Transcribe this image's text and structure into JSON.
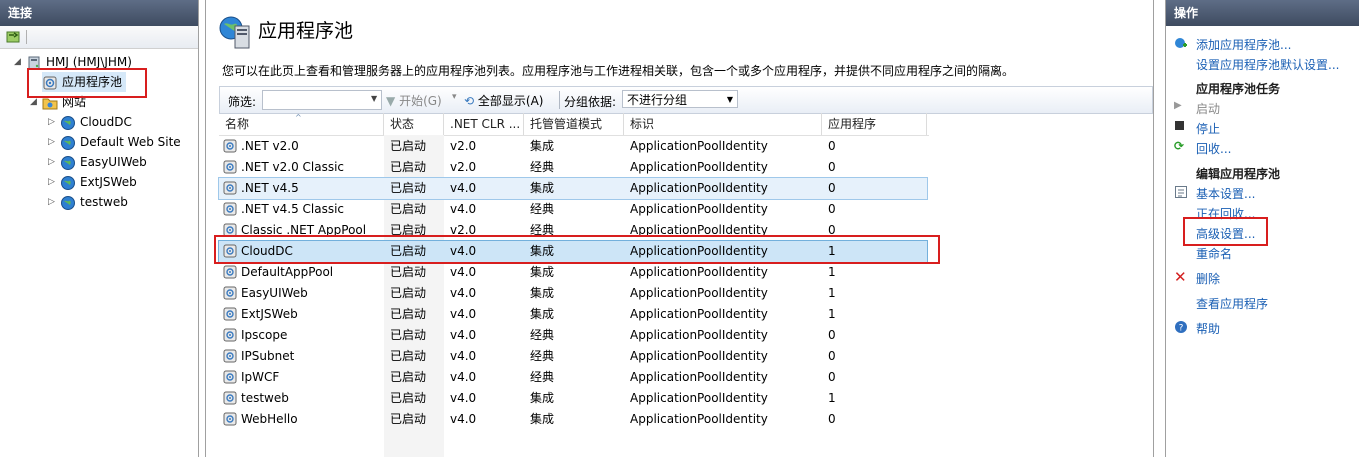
{
  "connections": {
    "header": "连接",
    "tree": {
      "server": "HMJ (HMJ\\JHM)",
      "app_pools": "应用程序池",
      "sites": "网站",
      "site_items": [
        "CloudDC",
        "Default Web Site",
        "EasyUIWeb",
        "ExtJSWeb",
        "testweb"
      ]
    }
  },
  "main": {
    "title": "应用程序池",
    "description": "您可以在此页上查看和管理服务器上的应用程序池列表。应用程序池与工作进程相关联，包含一个或多个应用程序，并提供不同应用程序之间的隔离。",
    "filterbar": {
      "filter_label": "筛选:",
      "start_label": "开始(G)",
      "show_all_label": "全部显示(A)",
      "group_label": "分组依据:",
      "group_value": "不进行分组"
    },
    "columns": [
      "名称",
      "状态",
      ".NET CLR ...",
      "托管管道模式",
      "标识",
      "应用程序"
    ],
    "rows": [
      [
        ".NET v2.0",
        "已启动",
        "v2.0",
        "集成",
        "ApplicationPoolIdentity",
        "0"
      ],
      [
        ".NET v2.0 Classic",
        "已启动",
        "v2.0",
        "经典",
        "ApplicationPoolIdentity",
        "0"
      ],
      [
        ".NET v4.5",
        "已启动",
        "v4.0",
        "集成",
        "ApplicationPoolIdentity",
        "0"
      ],
      [
        ".NET v4.5 Classic",
        "已启动",
        "v4.0",
        "经典",
        "ApplicationPoolIdentity",
        "0"
      ],
      [
        "Classic .NET AppPool",
        "已启动",
        "v2.0",
        "经典",
        "ApplicationPoolIdentity",
        "0"
      ],
      [
        "CloudDC",
        "已启动",
        "v4.0",
        "集成",
        "ApplicationPoolIdentity",
        "1"
      ],
      [
        "DefaultAppPool",
        "已启动",
        "v4.0",
        "集成",
        "ApplicationPoolIdentity",
        "1"
      ],
      [
        "EasyUIWeb",
        "已启动",
        "v4.0",
        "集成",
        "ApplicationPoolIdentity",
        "1"
      ],
      [
        "ExtJSWeb",
        "已启动",
        "v4.0",
        "集成",
        "ApplicationPoolIdentity",
        "1"
      ],
      [
        "Ipscope",
        "已启动",
        "v4.0",
        "经典",
        "ApplicationPoolIdentity",
        "0"
      ],
      [
        "IPSubnet",
        "已启动",
        "v4.0",
        "经典",
        "ApplicationPoolIdentity",
        "0"
      ],
      [
        "IpWCF",
        "已启动",
        "v4.0",
        "经典",
        "ApplicationPoolIdentity",
        "0"
      ],
      [
        "testweb",
        "已启动",
        "v4.0",
        "集成",
        "ApplicationPoolIdentity",
        "1"
      ],
      [
        "WebHello",
        "已启动",
        "v4.0",
        "集成",
        "ApplicationPoolIdentity",
        "0"
      ]
    ]
  },
  "actions": {
    "header": "操作",
    "add_pool": "添加应用程序池...",
    "set_defaults": "设置应用程序池默认设置...",
    "tasks_title": "应用程序池任务",
    "start": "启动",
    "stop": "停止",
    "recycle": "回收...",
    "edit_title": "编辑应用程序池",
    "basic_settings": "基本设置...",
    "recycling": "正在回收...",
    "advanced_settings": "高级设置...",
    "rename": "重命名",
    "delete": "删除",
    "view_apps": "查看应用程序",
    "help": "帮助"
  },
  "colors": {
    "highlight_border": "#d81e1e",
    "header_bg": "#4a5870",
    "link": "#1a5fb4",
    "selected_row": "#cde5f7"
  }
}
